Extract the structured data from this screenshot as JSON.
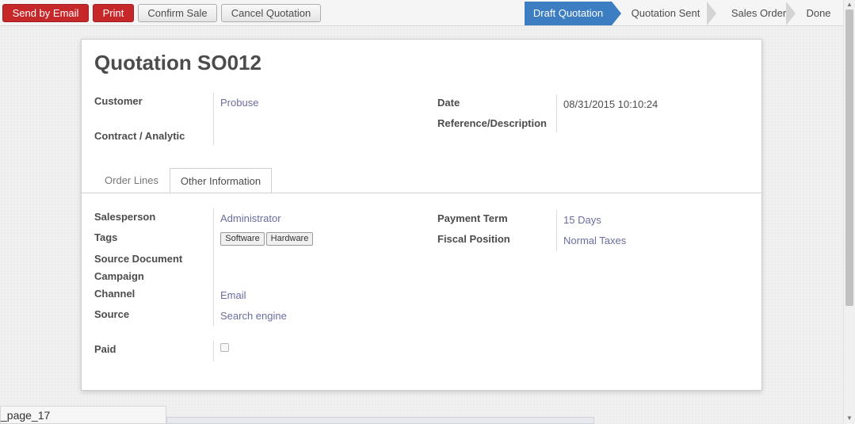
{
  "toolbar": {
    "send_email": "Send by Email",
    "print": "Print",
    "confirm_sale": "Confirm Sale",
    "cancel_quotation": "Cancel Quotation"
  },
  "status_steps": [
    "Draft Quotation",
    "Quotation Sent",
    "Sales Order",
    "Done"
  ],
  "active_status": "Draft Quotation",
  "form": {
    "title_prefix": "Quotation",
    "title_number": "SO012",
    "customer_label": "Customer",
    "customer_value": "Probuse",
    "contract_label": "Contract / Analytic",
    "date_label": "Date",
    "date_value": "08/31/2015 10:10:24",
    "reference_label": "Reference/Description"
  },
  "tabs": [
    "Order Lines",
    "Other Information"
  ],
  "active_tab": "Other Information",
  "other_info": {
    "salesperson_label": "Salesperson",
    "salesperson_value": "Administrator",
    "tags_label": "Tags",
    "tags": [
      "Software",
      "Hardware"
    ],
    "source_document_label": "Source Document",
    "campaign_label": "Campaign",
    "channel_label": "Channel",
    "channel_value": "Email",
    "source_label": "Source",
    "source_value": "Search engine",
    "paid_label": "Paid",
    "paid_checked": false,
    "payment_term_label": "Payment Term",
    "payment_term_value": "15 Days",
    "fiscal_position_label": "Fiscal Position",
    "fiscal_position_value": "Normal Taxes"
  },
  "bottom_tab_label": "_page_17",
  "colors": {
    "primary_red": "#c6282a",
    "status_active": "#3d7ec2",
    "link_value": "#6a6d9f"
  }
}
